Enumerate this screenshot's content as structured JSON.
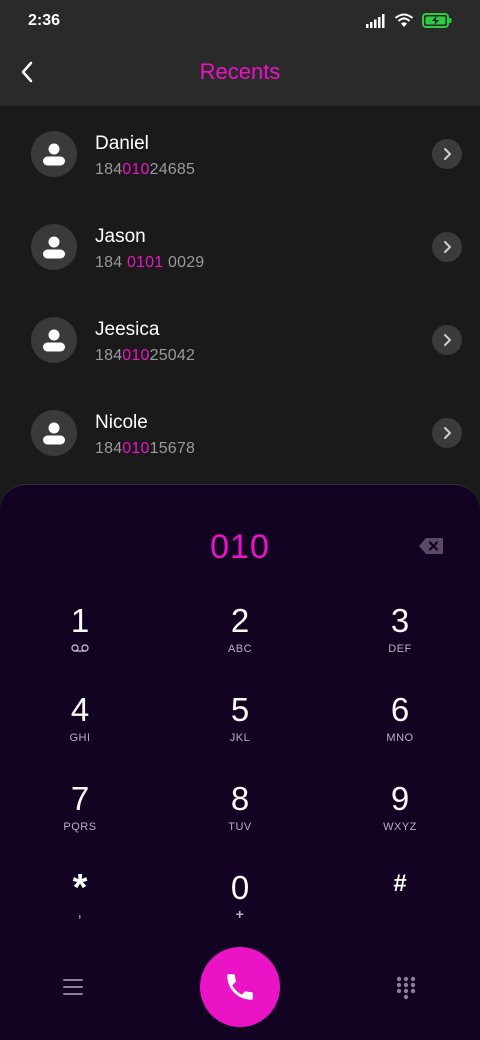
{
  "status_bar": {
    "time": "2:36",
    "icons": [
      "signal-icon",
      "wifi-icon",
      "battery-charging-icon"
    ],
    "battery_color": "#2ecc40"
  },
  "header": {
    "title": "Recents",
    "back_icon": "chevron-left-icon",
    "accent_color": "#ea14c6"
  },
  "recents": [
    {
      "name": "Daniel",
      "number_pre": "184",
      "number_match": "010",
      "number_post": "24685"
    },
    {
      "name": "Jason",
      "number_pre": "184 ",
      "number_match": "0101",
      "number_post": " 0029"
    },
    {
      "name": "Jeesica",
      "number_pre": "184",
      "number_match": "010",
      "number_post": "25042"
    },
    {
      "name": "Nicole",
      "number_pre": "184",
      "number_match": "010",
      "number_post": "15678"
    }
  ],
  "dialpad": {
    "input": "010",
    "keys": [
      {
        "digit": "1",
        "letters": ""
      },
      {
        "digit": "2",
        "letters": "ABC"
      },
      {
        "digit": "3",
        "letters": "DEF"
      },
      {
        "digit": "4",
        "letters": "GHI"
      },
      {
        "digit": "5",
        "letters": "JKL"
      },
      {
        "digit": "6",
        "letters": "MNO"
      },
      {
        "digit": "7",
        "letters": "PQRS"
      },
      {
        "digit": "8",
        "letters": "TUV"
      },
      {
        "digit": "9",
        "letters": "WXYZ"
      },
      {
        "digit": "*",
        "letters": ","
      },
      {
        "digit": "0",
        "letters": "+"
      },
      {
        "digit": "#",
        "letters": ""
      }
    ],
    "call_color": "#ea14c6"
  }
}
